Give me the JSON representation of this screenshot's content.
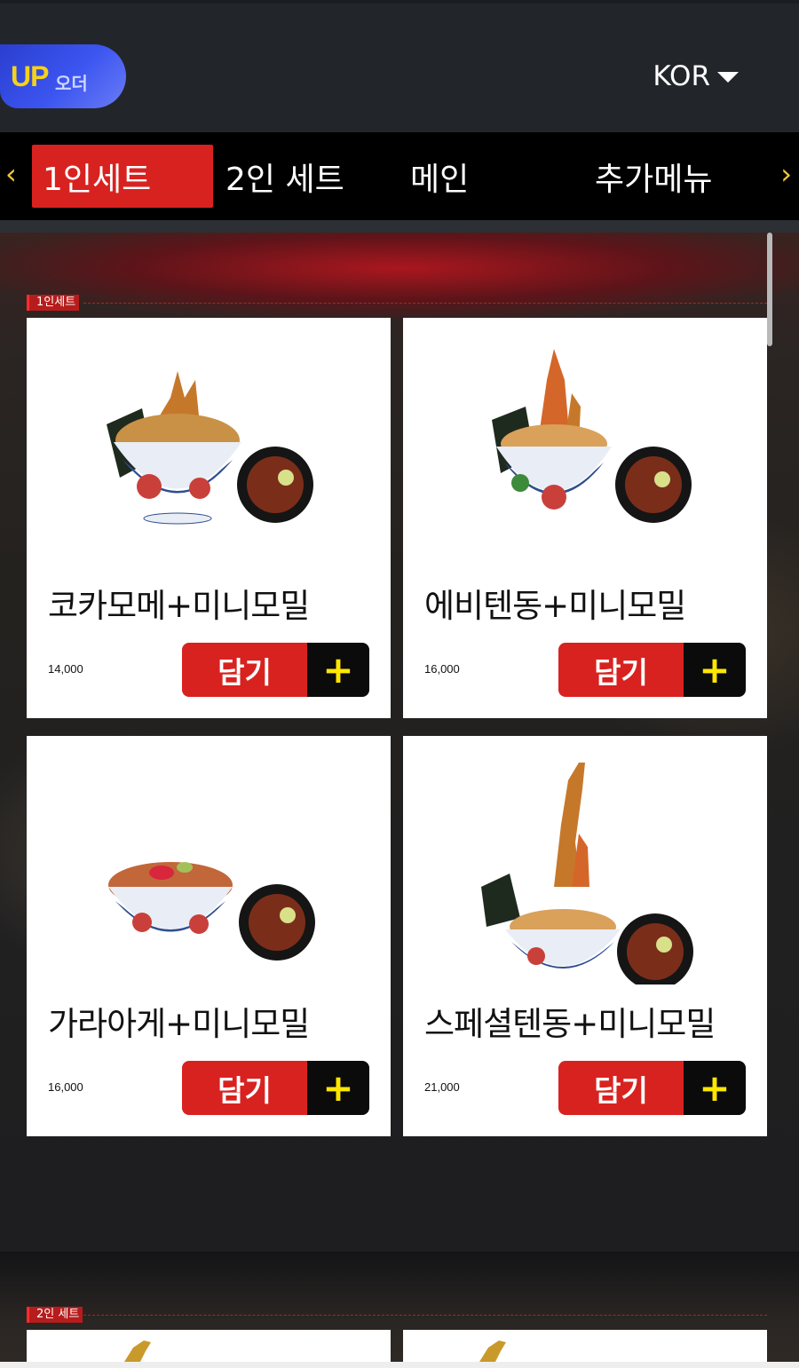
{
  "header": {
    "logo_up": "UP",
    "logo_ko": "오더",
    "language": "KOR",
    "language_icon": "chevron-down-icon"
  },
  "nav": {
    "prev_icon": "‹",
    "next_icon": "›",
    "tabs": [
      {
        "label": "1인세트",
        "active": true
      },
      {
        "label": "2인 세트",
        "active": false
      },
      {
        "label": "메인",
        "active": false
      },
      {
        "label": "추가메뉴",
        "active": false
      }
    ]
  },
  "sections": [
    {
      "title": "1인세트",
      "items": [
        {
          "name": "코카모메+미니모밀",
          "price": "14,000",
          "add_label": "담기",
          "add_icon": "+"
        },
        {
          "name": "에비텐동+미니모밀",
          "price": "16,000",
          "add_label": "담기",
          "add_icon": "+"
        },
        {
          "name": "가라아게+미니모밀",
          "price": "16,000",
          "add_label": "담기",
          "add_icon": "+"
        },
        {
          "name": "스페셜텐동+미니모밀",
          "price": "21,000",
          "add_label": "담기",
          "add_icon": "+"
        }
      ]
    },
    {
      "title": "2인 세트",
      "items": []
    }
  ],
  "colors": {
    "accent_red": "#d82220",
    "plus_yellow": "#ffe600",
    "header_bg": "#22262b",
    "nav_bg": "#000000"
  }
}
